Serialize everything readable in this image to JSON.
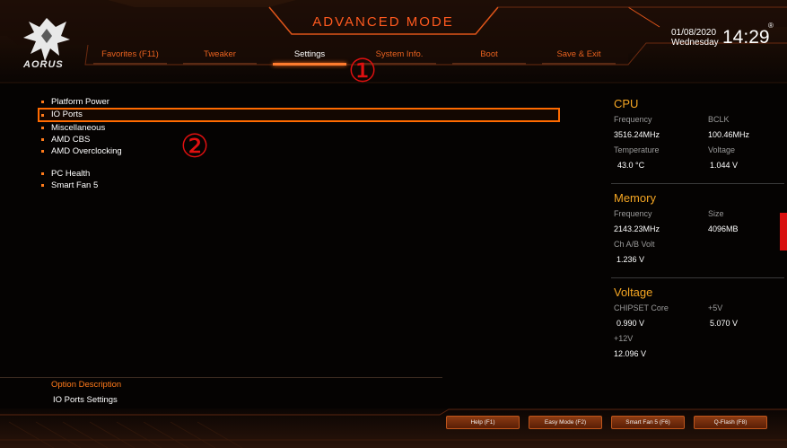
{
  "header": {
    "brand": "AORUS",
    "mode_title": "ADVANCED MODE",
    "date": "01/08/2020",
    "weekday": "Wednesday",
    "time": "14:29",
    "reg_mark": "®"
  },
  "tabs": [
    {
      "label": "Favorites (F11)",
      "active": false
    },
    {
      "label": "Tweaker",
      "active": false
    },
    {
      "label": "Settings",
      "active": true
    },
    {
      "label": "System Info.",
      "active": false
    },
    {
      "label": "Boot",
      "active": false
    },
    {
      "label": "Save & Exit",
      "active": false
    }
  ],
  "annotations": {
    "one": "①",
    "two": "②"
  },
  "menu": {
    "group1": [
      "Platform Power",
      "IO Ports",
      "Miscellaneous",
      "AMD CBS",
      "AMD Overclocking"
    ],
    "group2": [
      "PC Health",
      "Smart Fan 5"
    ],
    "selected": "IO Ports"
  },
  "option_description": {
    "title": "Option Description",
    "text": "IO Ports Settings"
  },
  "side": {
    "cpu": {
      "title": "CPU",
      "freq_label": "Frequency",
      "freq_value": "3516.24MHz",
      "bclk_label": "BCLK",
      "bclk_value": "100.46MHz",
      "temp_label": "Temperature",
      "temp_value": "43.0 °C",
      "volt_label": "Voltage",
      "volt_value": "1.044 V"
    },
    "memory": {
      "title": "Memory",
      "freq_label": "Frequency",
      "freq_value": "2143.23MHz",
      "size_label": "Size",
      "size_value": "4096MB",
      "volt_label": "Ch A/B Volt",
      "volt_value": "1.236 V"
    },
    "voltage": {
      "title": "Voltage",
      "chipset_label": "CHIPSET Core",
      "chipset_value": "0.990 V",
      "v5_label": "+5V",
      "v5_value": "5.070 V",
      "v12_label": "+12V",
      "v12_value": "12.096 V"
    }
  },
  "buttons": [
    {
      "label": "Help (F1)"
    },
    {
      "label": "Easy Mode (F2)"
    },
    {
      "label": "Smart Fan 5 (F6)"
    },
    {
      "label": "Q-Flash (F8)"
    }
  ],
  "colors": {
    "accent": "#ff6a00",
    "section_title": "#f5a623",
    "annotation": "#e01010",
    "background": "#050302"
  },
  "icons": [
    "aorus-eagle-logo"
  ]
}
